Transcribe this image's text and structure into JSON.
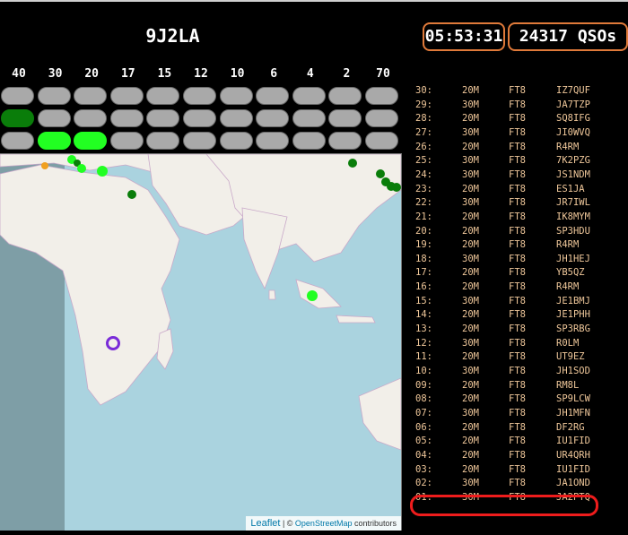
{
  "header": {
    "callsign": "9J2LA",
    "clock": "05:53:31",
    "qso_count": "24317 QSOs"
  },
  "bands": {
    "labels": [
      "40",
      "30",
      "20",
      "17",
      "15",
      "12",
      "10",
      "6",
      "4",
      "2",
      "70"
    ],
    "rows": [
      [
        "off",
        "off",
        "off",
        "off",
        "off",
        "off",
        "off",
        "off",
        "off",
        "off",
        "off"
      ],
      [
        "dark",
        "off",
        "off",
        "off",
        "off",
        "off",
        "off",
        "off",
        "off",
        "off",
        "off"
      ],
      [
        "off",
        "bright",
        "bright",
        "off",
        "off",
        "off",
        "off",
        "off",
        "off",
        "off",
        "off"
      ]
    ]
  },
  "map": {
    "attribution_leaflet": "Leaflet",
    "attribution_sep": " | © ",
    "attribution_osm": "OpenStreetMap",
    "attribution_suffix": " contributors"
  },
  "colors": {
    "accent_box": "#e07a3a",
    "log_text": "#efc79a",
    "highlight": "#ee1c1c",
    "pill_off": "#a9a9a9",
    "pill_dark": "#0a7d0a",
    "pill_bright": "#22ff22"
  },
  "log": [
    {
      "num": "30:",
      "band": "20M",
      "mode": "FT8",
      "call": "IZ7QUF"
    },
    {
      "num": "29:",
      "band": "30M",
      "mode": "FT8",
      "call": "JA7TZP"
    },
    {
      "num": "28:",
      "band": "20M",
      "mode": "FT8",
      "call": "SQ8IFG"
    },
    {
      "num": "27:",
      "band": "30M",
      "mode": "FT8",
      "call": "JI0WVQ"
    },
    {
      "num": "26:",
      "band": "20M",
      "mode": "FT8",
      "call": "R4RM"
    },
    {
      "num": "25:",
      "band": "30M",
      "mode": "FT8",
      "call": "7K2PZG"
    },
    {
      "num": "24:",
      "band": "30M",
      "mode": "FT8",
      "call": "JS1NDM"
    },
    {
      "num": "23:",
      "band": "20M",
      "mode": "FT8",
      "call": "ES1JA"
    },
    {
      "num": "22:",
      "band": "30M",
      "mode": "FT8",
      "call": "JR7IWL"
    },
    {
      "num": "21:",
      "band": "20M",
      "mode": "FT8",
      "call": "IK8MYM"
    },
    {
      "num": "20:",
      "band": "20M",
      "mode": "FT8",
      "call": "SP3HDU"
    },
    {
      "num": "19:",
      "band": "20M",
      "mode": "FT8",
      "call": "R4RM"
    },
    {
      "num": "18:",
      "band": "30M",
      "mode": "FT8",
      "call": "JH1HEJ"
    },
    {
      "num": "17:",
      "band": "20M",
      "mode": "FT8",
      "call": "YB5QZ"
    },
    {
      "num": "16:",
      "band": "20M",
      "mode": "FT8",
      "call": "R4RM"
    },
    {
      "num": "15:",
      "band": "30M",
      "mode": "FT8",
      "call": "JE1BMJ"
    },
    {
      "num": "14:",
      "band": "20M",
      "mode": "FT8",
      "call": "JE1PHH"
    },
    {
      "num": "13:",
      "band": "20M",
      "mode": "FT8",
      "call": "SP3RBG"
    },
    {
      "num": "12:",
      "band": "30M",
      "mode": "FT8",
      "call": "R0LM"
    },
    {
      "num": "11:",
      "band": "20M",
      "mode": "FT8",
      "call": "UT9EZ"
    },
    {
      "num": "10:",
      "band": "30M",
      "mode": "FT8",
      "call": "JH1SOD"
    },
    {
      "num": "09:",
      "band": "20M",
      "mode": "FT8",
      "call": "RM8L"
    },
    {
      "num": "08:",
      "band": "20M",
      "mode": "FT8",
      "call": "SP9LCW"
    },
    {
      "num": "07:",
      "band": "30M",
      "mode": "FT8",
      "call": "JH1MFN"
    },
    {
      "num": "06:",
      "band": "20M",
      "mode": "FT8",
      "call": "DF2RG"
    },
    {
      "num": "05:",
      "band": "20M",
      "mode": "FT8",
      "call": "IU1FID"
    },
    {
      "num": "04:",
      "band": "20M",
      "mode": "FT8",
      "call": "UR4QRH"
    },
    {
      "num": "03:",
      "band": "20M",
      "mode": "FT8",
      "call": "IU1FID"
    },
    {
      "num": "02:",
      "band": "30M",
      "mode": "FT8",
      "call": "JA1OND"
    },
    {
      "num": "01:",
      "band": "30M",
      "mode": "FT8",
      "call": "JA2PTQ"
    }
  ]
}
